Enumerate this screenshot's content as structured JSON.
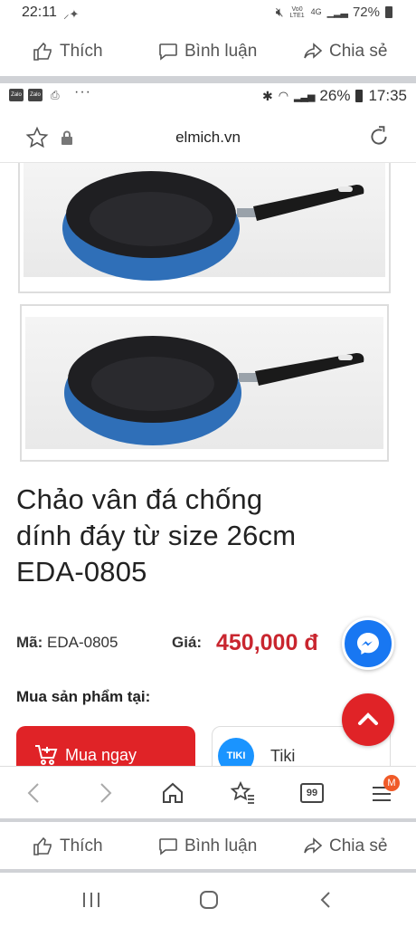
{
  "outer_status": {
    "time": "22:11",
    "network": "Vo0 LTE1",
    "net_4g": "4G",
    "battery": "72%"
  },
  "fb_bar_top": {
    "like": "Thích",
    "comment": "Bình luận",
    "share": "Chia sẻ"
  },
  "inner_status": {
    "battery": "26%",
    "time": "17:35",
    "app_icons": [
      "Zalo",
      "Zalo"
    ],
    "more": "···"
  },
  "browser": {
    "url": "elmich.vn"
  },
  "product": {
    "title_line1": "Chảo vân đá chống",
    "title_line2": "dính đáy từ size 26cm",
    "title_line3": "EDA-0805",
    "code_label": "Mã:",
    "code_value": "EDA-0805",
    "price_label": "Giá:",
    "price_value": "450,000 đ",
    "buy_at_label": "Mua sản phẩm tại:",
    "buy_now": "Mua ngay",
    "tiki_logo": "TIKI",
    "tiki_name": "Tiki"
  },
  "toolbar": {
    "tabs_count": "99",
    "menu_badge": "M"
  },
  "fb_bar_bottom": {
    "like": "Thích",
    "comment": "Bình luận",
    "share": "Chia sẻ"
  },
  "colors": {
    "accent_red": "#e02327",
    "price_red": "#c9262f",
    "pan_blue": "#2f6fb8",
    "messenger": "#1877f2",
    "tiki": "#1a94ff"
  }
}
